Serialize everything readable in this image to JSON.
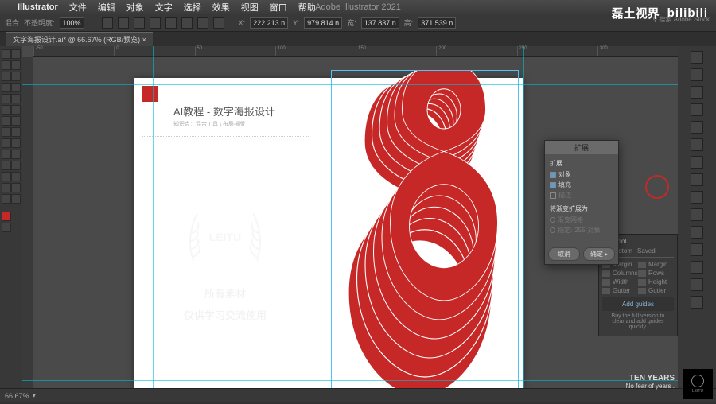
{
  "mac_menu": {
    "app": "Illustrator",
    "items": [
      "文件",
      "编辑",
      "对象",
      "文字",
      "选择",
      "效果",
      "视图",
      "窗口",
      "帮助"
    ]
  },
  "app_title": "Adobe Illustrator 2021",
  "search_placeholder": "搜索 Adobe Stock",
  "options": {
    "left_label": "混合",
    "opacity_label": "不透明度:",
    "opacity_value": "100%",
    "x_label": "X:",
    "x_value": "222.213 n",
    "y_label": "Y:",
    "y_value": "979.814 n",
    "w_label": "宽:",
    "w_value": "137.837 n",
    "h_label": "高:",
    "h_value": "371.539 n"
  },
  "tab": "文字海报设计.ai* @ 66.67% (RGB/预览)",
  "artboard": {
    "title": "AI教程 - 数字海报设计",
    "subtitle": "知识点：混合工具 \\ 布局排版",
    "wm1": "所有素材",
    "wm2": "仅供学习交流使用"
  },
  "ruler_marks": [
    "-50",
    "0",
    "50",
    "100",
    "150",
    "200",
    "250",
    "300"
  ],
  "dialog": {
    "title": "扩展",
    "section1": "扩展",
    "opt_object": "对象",
    "opt_fill": "填充",
    "opt_stroke": "描边",
    "section2": "将渐变扩展为",
    "opt_gradient": "渐变网格",
    "opt_specify": "指定:",
    "opt_specify_val": "255",
    "opt_specify_unit": "对象",
    "btn_cancel": "取消",
    "btn_ok": "确定"
  },
  "guide_panel": {
    "title": "uide friol",
    "tabs": [
      "n",
      "Custom",
      "Saved"
    ],
    "rows": [
      [
        "Margin",
        "Margin"
      ],
      [
        "Columns",
        "Rows"
      ],
      [
        "Width",
        "Height"
      ],
      [
        "Gutter",
        "Gutter"
      ]
    ],
    "add": "Add guides",
    "buy": "Buy the full version to clear and add guides quickly."
  },
  "status": {
    "zoom": "66.67%"
  },
  "watermark": {
    "text": "磊土视界",
    "bili": "bilibili"
  },
  "bottom": {
    "ty": "TEN YEARS",
    "sub": "No fear of years .",
    "brand": "LEITU"
  }
}
